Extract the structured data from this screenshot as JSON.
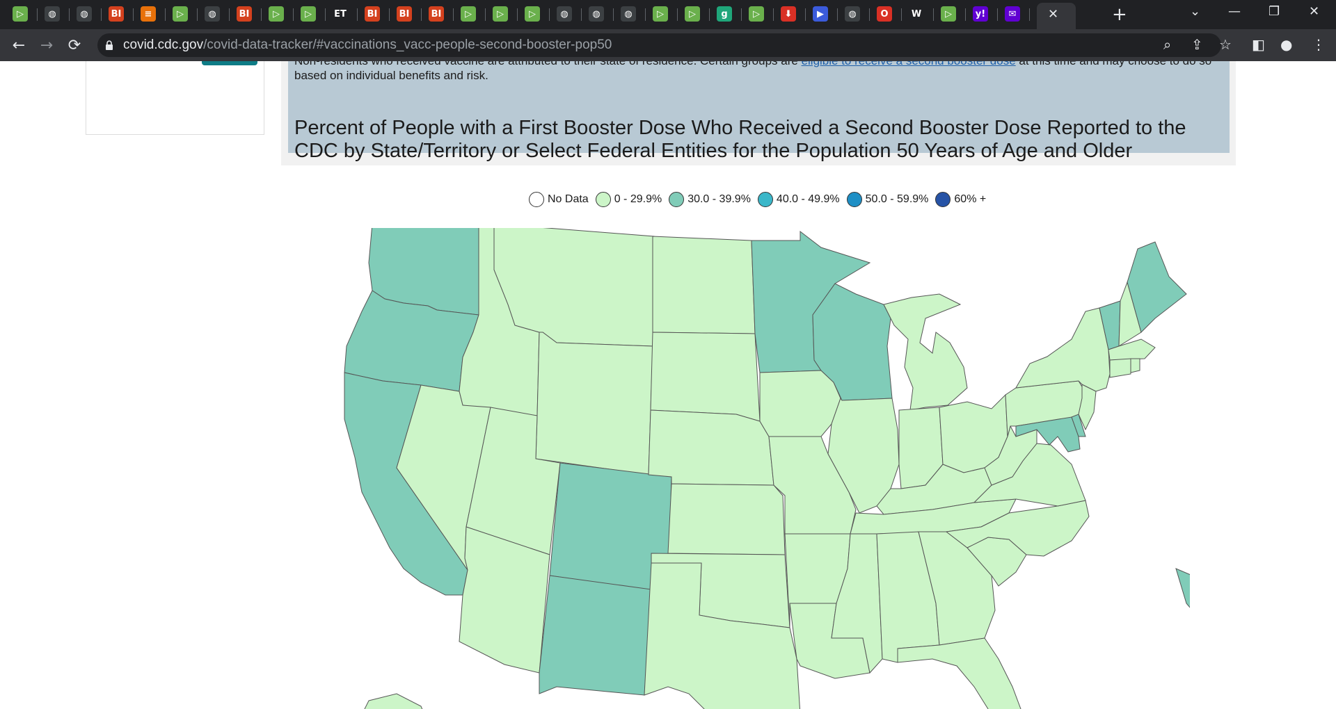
{
  "browser": {
    "url_host": "covid.cdc.gov",
    "url_path": "/covid-data-tracker/#vaccinations_vacc-people-second-booster-pop50",
    "tab_icons": [
      {
        "name": "play-icon",
        "glyph": "▷",
        "color": "#6ab04c"
      },
      {
        "name": "globe-icon",
        "glyph": "◍",
        "color": "#3c4043"
      },
      {
        "name": "globe-icon",
        "glyph": "◍",
        "color": "#3c4043"
      },
      {
        "name": "bi-icon",
        "glyph": "BI",
        "color": "#d4411e"
      },
      {
        "name": "bookmark-icon",
        "glyph": "≡",
        "color": "#e8710a"
      },
      {
        "name": "play-icon",
        "glyph": "▷",
        "color": "#6ab04c"
      },
      {
        "name": "globe-icon",
        "glyph": "◍",
        "color": "#3c4043"
      },
      {
        "name": "bi-icon",
        "glyph": "BI",
        "color": "#d4411e"
      },
      {
        "name": "play-icon",
        "glyph": "▷",
        "color": "#6ab04c"
      },
      {
        "name": "play-icon",
        "glyph": "▷",
        "color": "#6ab04c"
      },
      {
        "name": "et-icon",
        "glyph": "ET",
        "color": "#202124"
      },
      {
        "name": "bi-icon",
        "glyph": "BI",
        "color": "#d4411e"
      },
      {
        "name": "bi-icon",
        "glyph": "BI",
        "color": "#d4411e"
      },
      {
        "name": "bi-icon",
        "glyph": "BI",
        "color": "#d4411e"
      },
      {
        "name": "play-icon",
        "glyph": "▷",
        "color": "#6ab04c"
      },
      {
        "name": "play-icon",
        "glyph": "▷",
        "color": "#6ab04c"
      },
      {
        "name": "play-icon",
        "glyph": "▷",
        "color": "#6ab04c"
      },
      {
        "name": "globe-icon",
        "glyph": "◍",
        "color": "#3c4043"
      },
      {
        "name": "globe-icon",
        "glyph": "◍",
        "color": "#3c4043"
      },
      {
        "name": "globe-icon",
        "glyph": "◍",
        "color": "#3c4043"
      },
      {
        "name": "play-icon",
        "glyph": "▷",
        "color": "#6ab04c"
      },
      {
        "name": "play-icon",
        "glyph": "▷",
        "color": "#6ab04c"
      },
      {
        "name": "g-icon",
        "glyph": "g",
        "color": "#1fa67a"
      },
      {
        "name": "play-icon",
        "glyph": "▷",
        "color": "#6ab04c"
      },
      {
        "name": "download-icon",
        "glyph": "⬇",
        "color": "#d93025"
      },
      {
        "name": "arrow-icon",
        "glyph": "▶",
        "color": "#3b5bdb"
      },
      {
        "name": "globe-icon",
        "glyph": "◍",
        "color": "#3c4043"
      },
      {
        "name": "opera-icon",
        "glyph": "O",
        "color": "#d93025"
      },
      {
        "name": "news-icon",
        "glyph": "W",
        "color": "#202124"
      },
      {
        "name": "play-icon",
        "glyph": "▷",
        "color": "#6ab04c"
      },
      {
        "name": "yahoo-icon",
        "glyph": "y!",
        "color": "#6001d2"
      },
      {
        "name": "mail-icon",
        "glyph": "✉",
        "color": "#6001d2"
      }
    ],
    "active_tab_close": "✕",
    "new_tab": "+",
    "window": {
      "chevron": "⌄",
      "minimize": "—",
      "restore": "❐",
      "close": "✕"
    }
  },
  "notice": {
    "line1_pre": "Non-residents who received vaccine are attributed to their state of residence. Certain groups are ",
    "line1_link": "eligible to receive a second booster dose",
    "line1_post": " at this time and may choose to do so",
    "line2": "based on individual benefits and risk."
  },
  "chart_title": "Percent of People with a First Booster Dose Who Received a Second Booster Dose Reported to the CDC by State/Territory or Select Federal Entities for the Population 50 Years of Age and Older",
  "legend": [
    {
      "label": "No Data",
      "color": "#ffffff"
    },
    {
      "label": "0 - 29.9%",
      "color": "#ccf5c8"
    },
    {
      "label": "30.0 - 39.9%",
      "color": "#80ccb8"
    },
    {
      "label": "40.0 - 49.9%",
      "color": "#3bb7c9"
    },
    {
      "label": "50.0 - 59.9%",
      "color": "#1e8fc5"
    },
    {
      "label": "60% +",
      "color": "#2653a6"
    }
  ],
  "chart_data": {
    "type": "choropleth",
    "title": "Percent of People with a First Booster Dose Who Received a Second Booster Dose Reported to the CDC by State/Territory or Select Federal Entities for the Population 50 Years of Age and Older",
    "bins": [
      "No Data",
      "0 - 29.9%",
      "30.0 - 39.9%",
      "40.0 - 49.9%",
      "50.0 - 59.9%",
      "60% +"
    ],
    "states_in_30_39_9": [
      "WA",
      "OR",
      "CA",
      "CO",
      "NM",
      "MN",
      "WI",
      "VT",
      "ME",
      "MD",
      "DE",
      "DC",
      "HI"
    ],
    "states_in_0_29_9": [
      "ID",
      "MT",
      "WY",
      "NV",
      "UT",
      "AZ",
      "ND",
      "SD",
      "NE",
      "KS",
      "OK",
      "TX",
      "IA",
      "MO",
      "AR",
      "LA",
      "IL",
      "MS",
      "AL",
      "TN",
      "KY",
      "IN",
      "OH",
      "MI",
      "GA",
      "FL",
      "SC",
      "NC",
      "VA",
      "WV",
      "PA",
      "NY",
      "NJ",
      "NH",
      "MA",
      "CT",
      "RI",
      "AK"
    ]
  }
}
